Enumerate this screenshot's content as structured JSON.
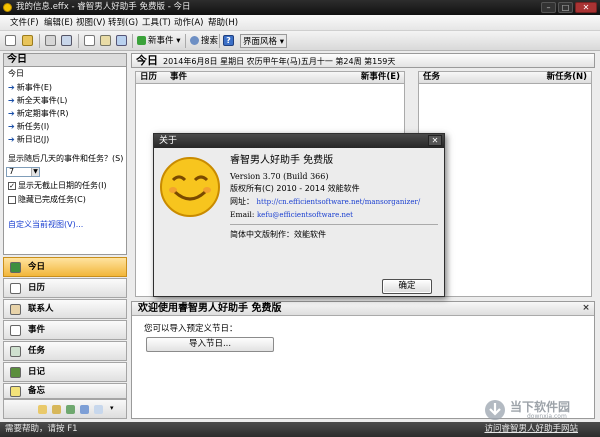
{
  "window": {
    "title": "我的信息.effx - 睿智男人好助手 免费版 - 今日",
    "controls": {
      "minimize": "–",
      "maximize": "□",
      "close": "✕"
    }
  },
  "menubar": {
    "items": [
      "文件(F)",
      "编辑(E)",
      "视图(V)",
      "转到(G)",
      "工具(T)",
      "动作(A)",
      "帮助(H)"
    ]
  },
  "toolbar": {
    "new_event": "新事件",
    "search": "搜索",
    "skin": "界面风格",
    "icons": [
      "new-doc-icon",
      "open-folder-icon",
      "print-icon",
      "cut-icon",
      "copy-icon",
      "paste-icon",
      "undo-icon",
      "redo-icon",
      "help-icon"
    ]
  },
  "left_pane": {
    "title": "今日",
    "section": "今日",
    "actions": [
      "新事件(E)",
      "新全天事件(L)",
      "新定期事件(R)",
      "新任务(I)",
      "新日记(J)"
    ],
    "days_question": "显示随后几天的事件和任务？(S)",
    "days_value": "7",
    "show_undated": "显示无截止日期的任务(I)",
    "show_undated_checked": true,
    "hide_completed": "隐藏已完成任务(C)",
    "hide_completed_checked": false,
    "customize": "自定义当前视图(V)..."
  },
  "nav": {
    "buttons": [
      "今日",
      "日历",
      "联系人",
      "事件",
      "任务",
      "日记",
      "备忘"
    ],
    "active": "今日"
  },
  "main": {
    "title": "今日",
    "date": "2014年6月8日 星期日 农历甲午年(马)五月十一 第24周 第159天",
    "calendar_header": "日历",
    "events_header": "事件",
    "new_event_link": "新事件(E)",
    "tasks_header": "任务",
    "new_task_link": "新任务(N)"
  },
  "welcome": {
    "title": "欢迎使用睿智男人好助手 免费版",
    "close": "×",
    "prompt": "您可以导入预定义节日：",
    "import_button": "导入节日..."
  },
  "about_dialog": {
    "title": "关于",
    "close": "✕",
    "product": "睿智男人好助手 免费版",
    "version": "Version 3.70 (Build 366)",
    "copyright": "版权所有(C) 2010 - 2014 效能软件",
    "website_label": "网址：",
    "website": "http://cn.efficientsoftware.net/mansorganizer/",
    "email_label": "Email:",
    "email": "kefu@efficientsoftware.net",
    "localization": "简体中文版制作：效能软件",
    "ok_button": "确定"
  },
  "status_bar": {
    "help_hint": "需要帮助，请按 F1",
    "visit_link": "访问睿智男人好助手网站"
  },
  "watermark": {
    "text": "当下软件园",
    "url": "downxia.com"
  },
  "colors": {
    "accent": "#f2b63a",
    "link": "#1a3fd0",
    "titlebar": "#1e1e1e",
    "face": "#f7c51e"
  }
}
